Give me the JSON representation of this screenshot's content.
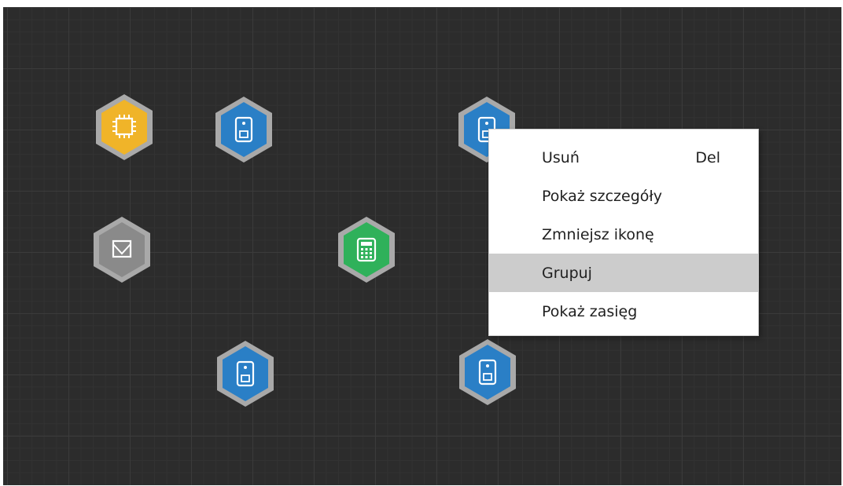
{
  "canvas": {
    "nodes": [
      {
        "id": "chip-node",
        "icon": "chip-icon",
        "color": "#f0b429"
      },
      {
        "id": "reader-node-top-left",
        "icon": "card-reader-icon",
        "color": "#2a7fc6"
      },
      {
        "id": "reader-node-top-right",
        "icon": "card-reader-icon",
        "color": "#2a7fc6"
      },
      {
        "id": "envelope-node",
        "icon": "envelope-icon",
        "color": "#8a8a8a"
      },
      {
        "id": "keypad-node",
        "icon": "keypad-icon",
        "color": "#2fb15a"
      },
      {
        "id": "reader-node-bottom-left",
        "icon": "card-reader-icon",
        "color": "#2a7fc6"
      },
      {
        "id": "reader-node-bottom-right",
        "icon": "card-reader-icon",
        "color": "#2a7fc6"
      }
    ]
  },
  "context_menu": {
    "items": [
      {
        "label": "Usuń",
        "shortcut": "Del"
      },
      {
        "label": "Pokaż szczegóły",
        "shortcut": ""
      },
      {
        "label": "Zmniejsz ikonę",
        "shortcut": ""
      },
      {
        "label": "Grupuj",
        "shortcut": "",
        "highlighted": true
      },
      {
        "label": "Pokaż zasięg",
        "shortcut": ""
      }
    ]
  }
}
